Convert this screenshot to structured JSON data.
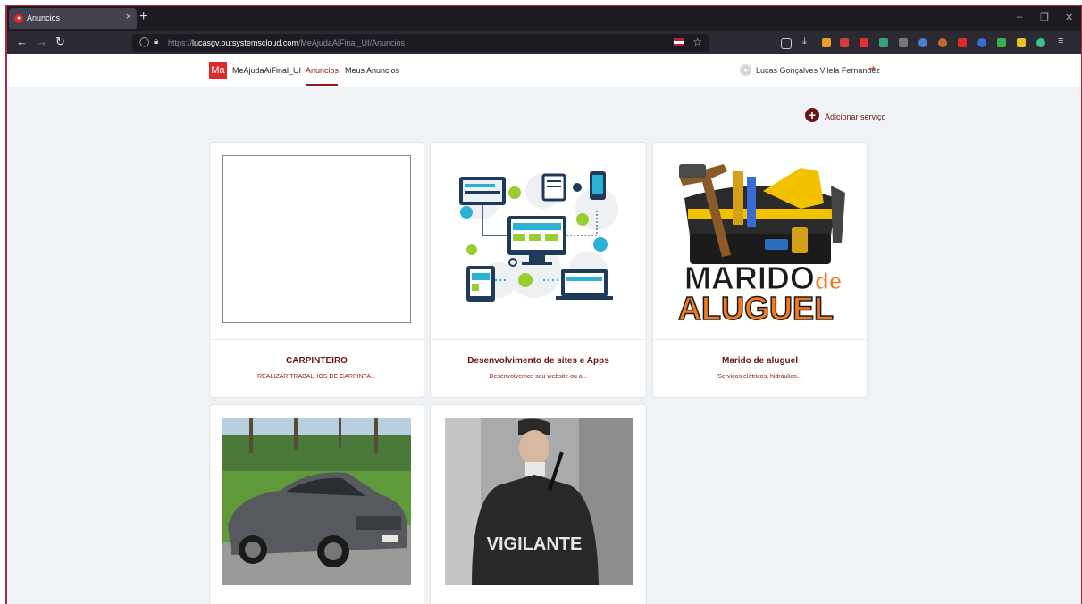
{
  "browser": {
    "tab_title": "Anuncios",
    "tab_close": "×",
    "new_tab": "+",
    "url_prefix": "https://",
    "url_host": "lucasgv.outsystemscloud.com",
    "url_path": "/MeAjudaAiFinal_UI/Anuncios",
    "win_min": "–",
    "win_restore": "❐",
    "win_close": "✕"
  },
  "app": {
    "logo": "Ma",
    "name": "MeAjudaAiFinal_UI",
    "nav": [
      "Anuncios",
      "Meus Anuncios"
    ],
    "user_name": "Lucas Gonçalves Vilela Fernandez"
  },
  "actions": {
    "add_service": "Adicionar serviço"
  },
  "cards": [
    {
      "title": "CARPINTEIRO",
      "desc": "REALIZAR TRABALHOS DE CARPINTA..."
    },
    {
      "title": "Desenvolvimento de sites e Apps",
      "desc": "Desenvolvemos seu website ou a..."
    },
    {
      "title": "Marido de aluguel",
      "desc": "Serviços elétricos, hidráulico..."
    },
    {
      "title": "",
      "desc": ""
    },
    {
      "title": "",
      "desc": ""
    }
  ],
  "images": {
    "marido_line1": "MARIDO",
    "marido_de": "de",
    "marido_line2": "ALUGUEL",
    "vigilante": "VIGILANTE"
  },
  "colors": {
    "accent": "#6b1414",
    "logo_bg": "#e02a2a",
    "browser_dark": "#1c1b22"
  }
}
